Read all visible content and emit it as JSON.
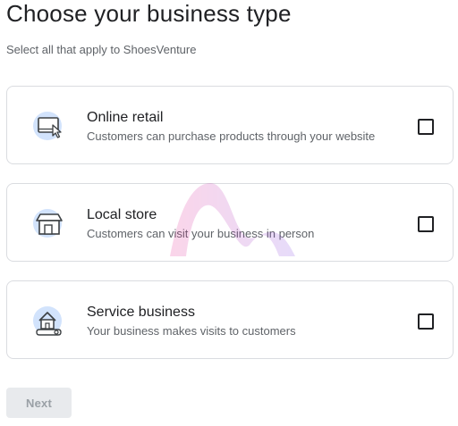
{
  "page": {
    "title": "Choose your business type",
    "subtitle": "Select all that apply to ShoesVenture"
  },
  "options": [
    {
      "name": "Online retail",
      "description": "Customers can purchase products through your website",
      "icon": "online-retail-icon",
      "checked": false
    },
    {
      "name": "Local store",
      "description": "Customers can visit your business in person",
      "icon": "storefront-icon",
      "checked": false
    },
    {
      "name": "Service business",
      "description": "Your business makes visits to customers",
      "icon": "service-house-icon",
      "checked": false
    }
  ],
  "actions": {
    "next_label": "Next",
    "next_disabled": true
  },
  "colors": {
    "icon_bg": "#d2e3fc",
    "icon_stroke": "#3c4043",
    "border": "#dadce0",
    "disabled_button_bg": "#e8eaed",
    "disabled_button_text": "#9aa0a6"
  }
}
